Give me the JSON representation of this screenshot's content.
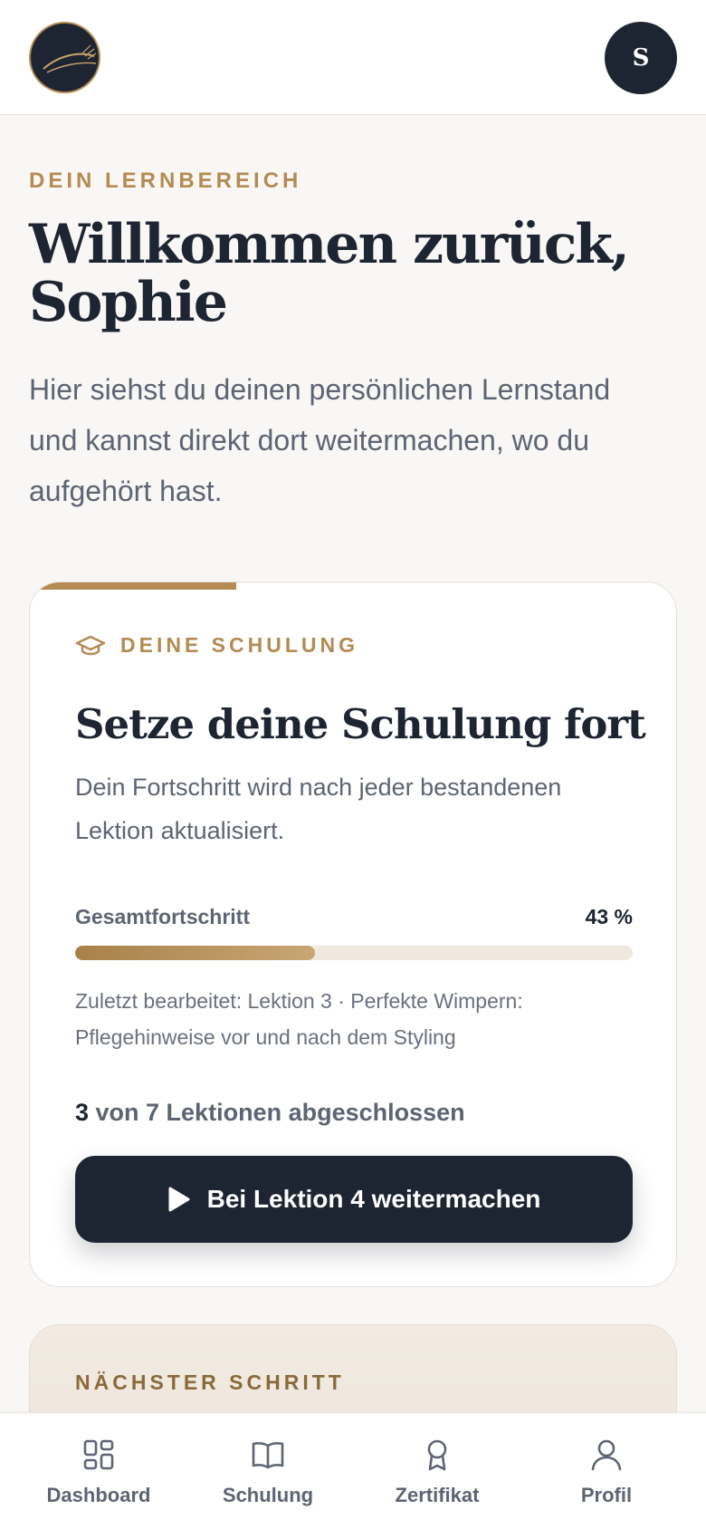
{
  "header": {
    "logo_icon": "moon-logo-icon",
    "avatar_initial": "S"
  },
  "welcome": {
    "eyebrow": "DEIN LERNBEREICH",
    "title_line1": "Willkommen zurück,",
    "title_line2": "Sophie",
    "intro": "Hier siehst du deinen persönlichen Lernstand und kannst direkt dort weitermachen, wo du aufgehört hast."
  },
  "course_card": {
    "tag_icon": "graduation-cap-icon",
    "tag": "DEINE SCHULUNG",
    "title": "Setze deine Schulung fort",
    "description": "Dein Fortschritt wird nach jeder bestandenen Lektion aktualisiert.",
    "progress_label": "Gesamtfortschritt",
    "progress_text": "43 %",
    "progress_value": 0.43,
    "last_edited": "Zuletzt bearbeitet: Lektion 3 · Perfekte Wimpern: Pflegehinweise vor und nach dem Styling",
    "lessons_done": "3",
    "lessons_rest": " von 7 Lektionen abgeschlossen",
    "cta_icon": "play-icon",
    "cta_label": "Bei Lektion 4 weitermachen"
  },
  "next_step": {
    "eyebrow": "NÄCHSTER SCHRITT"
  },
  "nav": {
    "items": [
      {
        "label": "Dashboard",
        "icon": "dashboard-grid-icon"
      },
      {
        "label": "Schulung",
        "icon": "book-icon"
      },
      {
        "label": "Zertifikat",
        "icon": "award-ribbon-icon"
      },
      {
        "label": "Profil",
        "icon": "user-icon"
      }
    ]
  },
  "colors": {
    "navy": "#1e2532",
    "gold": "#b48b52",
    "background": "#f8f7f5",
    "progress_track": "#f1e8dd"
  }
}
